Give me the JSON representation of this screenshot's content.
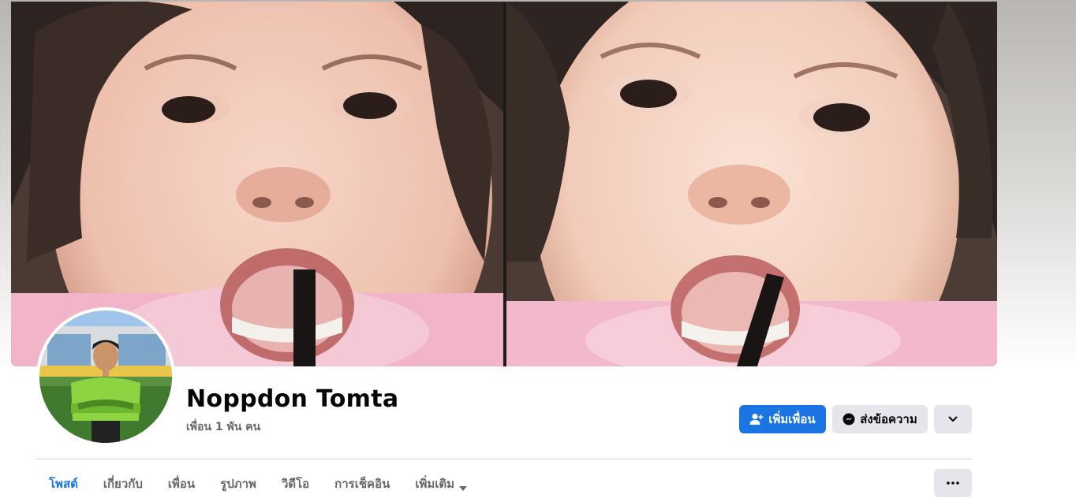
{
  "profile": {
    "name": "Noppdon Tomta",
    "friends_count": "เพื่อน 1 พัน คน"
  },
  "actions": {
    "add_friend": "เพิ่มเพื่อน",
    "message": "ส่งข้อความ"
  },
  "tabs": [
    {
      "label": "โพสต์",
      "active": true
    },
    {
      "label": "เกี่ยวกับ",
      "active": false
    },
    {
      "label": "เพื่อน",
      "active": false
    },
    {
      "label": "รูปภาพ",
      "active": false
    },
    {
      "label": "วิดีโอ",
      "active": false
    },
    {
      "label": "การเช็คอิน",
      "active": false
    },
    {
      "label": "เพิ่มเติม",
      "active": false
    }
  ],
  "icons": {
    "add_friend": "person-plus-icon",
    "message": "messenger-icon",
    "more": "chevron-down-icon",
    "tab_more": "caret-down-icon",
    "tab_options": "ellipsis-icon"
  },
  "colors": {
    "accent": "#1b74e4",
    "secondary_button": "#e4e6eb",
    "text_primary": "#050505",
    "text_secondary": "#65676b"
  }
}
